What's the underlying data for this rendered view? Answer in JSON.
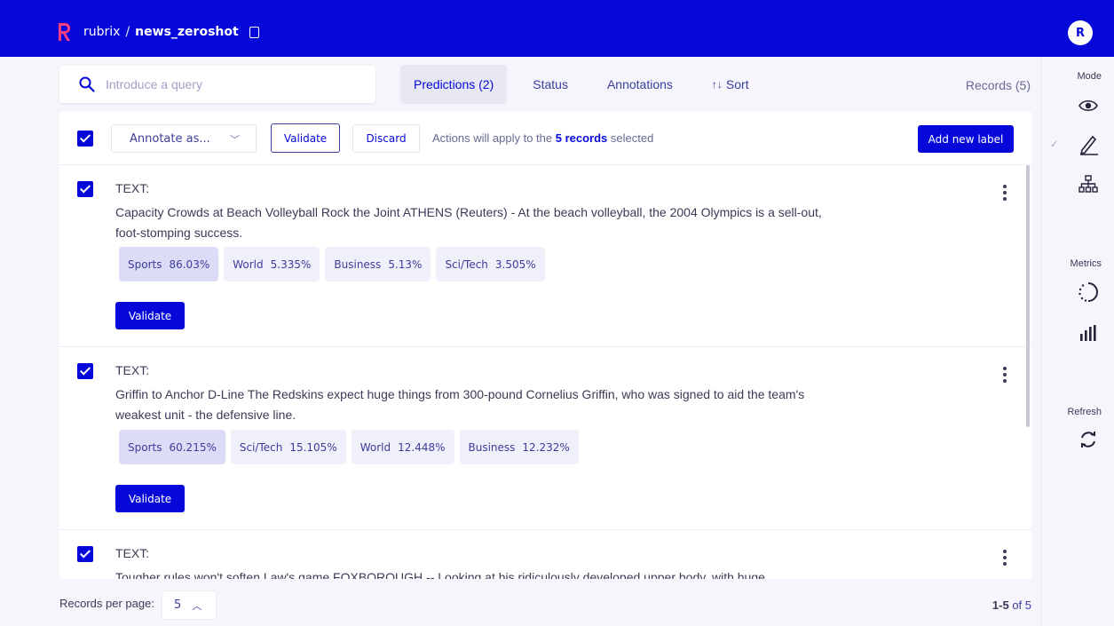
{
  "header": {
    "app_name": "rubrix",
    "separator": "/",
    "dataset": "news_zeroshot",
    "avatar_initial": "R",
    "brand_color": "#0508d9"
  },
  "search": {
    "placeholder": "Introduce a query"
  },
  "tabs": [
    {
      "label": "Predictions (2)",
      "active": true
    },
    {
      "label": "Status"
    },
    {
      "label": "Annotations"
    },
    {
      "label": "Sort",
      "prefix": "↑↓"
    }
  ],
  "records_count": "Records (5)",
  "bulk": {
    "annotate_label": "Annotate as...",
    "validate_label": "Validate",
    "discard_label": "Discard",
    "msg_prefix": "Actions will apply to the ",
    "msg_bold": "5 records",
    "msg_suffix": " selected",
    "add_label": "Add new label"
  },
  "records": [
    {
      "label": "TEXT:",
      "text": "Capacity Crowds at Beach Volleyball Rock the Joint ATHENS (Reuters) - At the beach volleyball, the 2004 Olympics is a sell-out, foot-stomping success.",
      "predictions": [
        {
          "name": "Sports",
          "score": "86.03%"
        },
        {
          "name": "World",
          "score": "5.335%"
        },
        {
          "name": "Business",
          "score": "5.13%"
        },
        {
          "name": "Sci/Tech",
          "score": "3.505%"
        }
      ],
      "validate_label": "Validate"
    },
    {
      "label": "TEXT:",
      "text": "Griffin to Anchor D-Line The Redskins expect huge things from 300-pound Cornelius Griffin, who was signed to aid the team's weakest unit - the defensive line.",
      "predictions": [
        {
          "name": "Sports",
          "score": "60.215%"
        },
        {
          "name": "Sci/Tech",
          "score": "15.105%"
        },
        {
          "name": "World",
          "score": "12.448%"
        },
        {
          "name": "Business",
          "score": "12.232%"
        }
      ],
      "validate_label": "Validate"
    },
    {
      "label": "TEXT:",
      "text": "Tougher rules won't soften Law's game FOXBOROUGH -- Looking at his ridiculously developed upper body, with huge"
    }
  ],
  "footer": {
    "rpp_label": "Records per page:",
    "rpp_value": "5",
    "pager_range": "1-5",
    "pager_total": " of 5"
  },
  "sidebar": {
    "mode_title": "Mode",
    "metrics_title": "Metrics",
    "refresh_title": "Refresh"
  }
}
